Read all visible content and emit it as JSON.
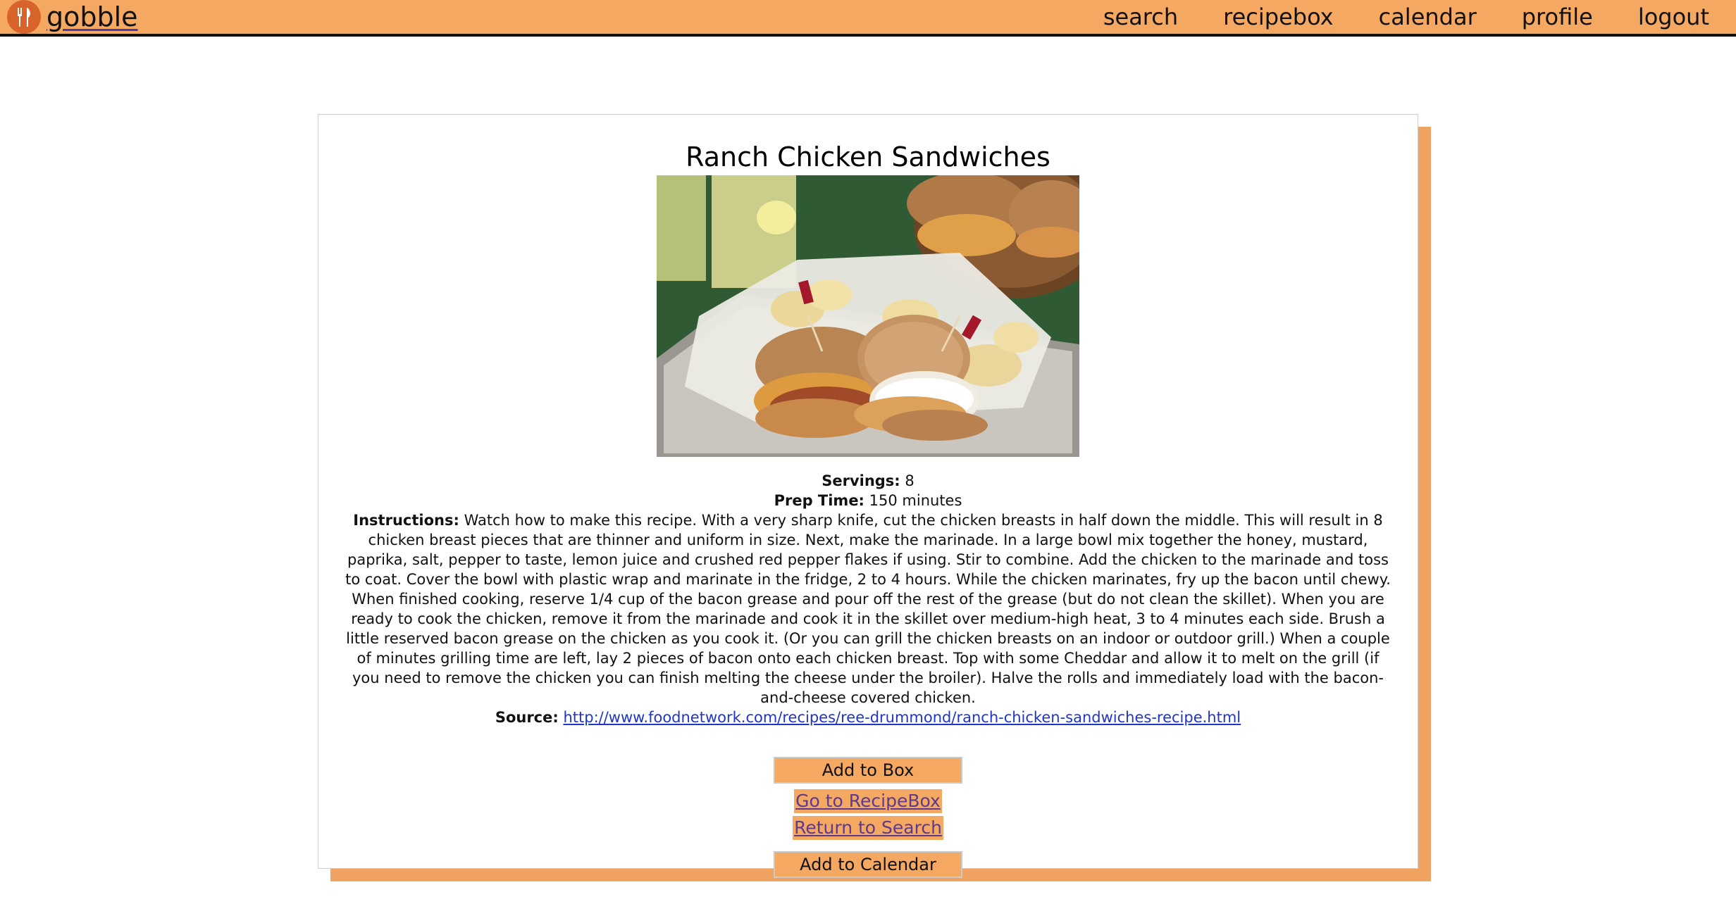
{
  "nav": {
    "brand": "gobble",
    "links": [
      "search",
      "recipebox",
      "calendar",
      "profile",
      "logout"
    ]
  },
  "recipe": {
    "title": "Ranch Chicken Sandwiches",
    "servings_label": "Servings:",
    "servings": "8",
    "prep_label": "Prep Time:",
    "prep_time": "150 minutes",
    "instructions_label": "Instructions:",
    "instructions": "Watch how to make this recipe. With a very sharp knife, cut the chicken breasts in half down the middle. This will result in 8 chicken breast pieces that are thinner and uniform in size. Next, make the marinade. In a large bowl mix together the honey, mustard, paprika, salt, pepper to taste, lemon juice and crushed red pepper flakes if using. Stir to combine. Add the chicken to the marinade and toss to coat. Cover the bowl with plastic wrap and marinate in the fridge, 2 to 4 hours. While the chicken marinates, fry up the bacon until chewy. When finished cooking, reserve 1/4 cup of the bacon grease and pour off the rest of the grease (but do not clean the skillet). When you are ready to cook the chicken, remove it from the marinade and cook it in the skillet over medium-high heat, 3 to 4 minutes each side. Brush a little reserved bacon grease on the chicken as you cook it. (Or you can grill the chicken breasts on an indoor or outdoor grill.) When a couple of minutes grilling time are left, lay 2 pieces of bacon onto each chicken breast. Top with some Cheddar and allow it to melt on the grill (if you need to remove the chicken you can finish melting the cheese under the broiler). Halve the rolls and immediately load with the bacon-and-cheese covered chicken.",
    "source_label": "Source:",
    "source_url": "http://www.foodnetwork.com/recipes/ree-drummond/ranch-chicken-sandwiches-recipe.html"
  },
  "actions": {
    "add_to_box": "Add to Box",
    "go_to_recipebox": "Go to RecipeBox",
    "return_to_search": "Return to Search",
    "add_to_calendar": "Add to Calendar"
  },
  "colors": {
    "accent": "#f4a862",
    "logo": "#d9642b",
    "link": "#1f35c9",
    "visited_link": "#5c3a8f"
  }
}
